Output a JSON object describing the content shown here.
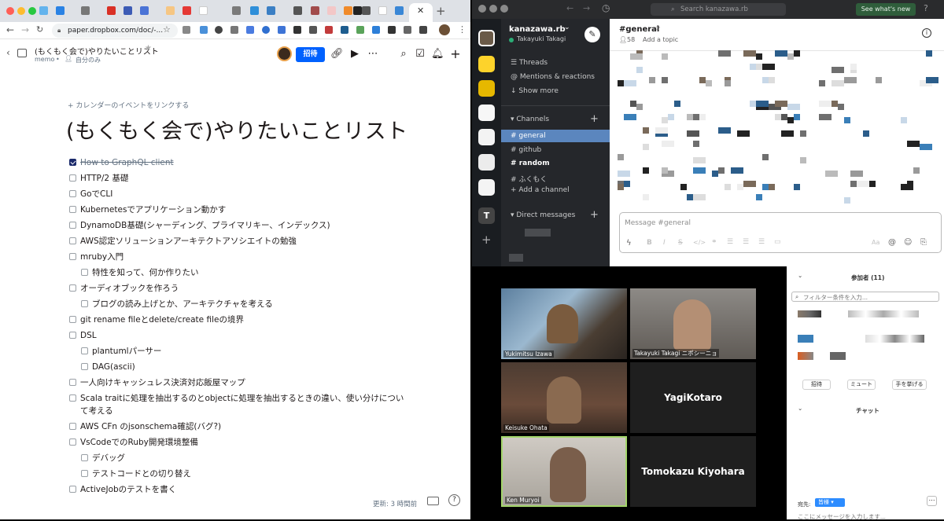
{
  "browser": {
    "url": "paper.dropbox.com/doc/-...",
    "colors": {
      "tabbar": "#dee1e6",
      "close": "#ff5f57",
      "minimize": "#febc2e",
      "maximize": "#28c840"
    }
  },
  "paper": {
    "doc_title_small": "(もくもく会で)やりたいことリスト",
    "meta_folder": "memo",
    "meta_sep": "•",
    "meta_visibility": "自分のみ",
    "share_label": "招待",
    "calendar_link": "+ カレンダーのイベントをリンクする",
    "title": "(もくもく会で)やりたいことリスト",
    "todos": [
      {
        "text": "How to GraphQL client",
        "checked": true
      },
      {
        "text": "HTTP/2 基礎",
        "checked": false
      },
      {
        "text": "GoでCLI",
        "checked": false
      },
      {
        "text": "Kubernetesでアプリケーション動かす",
        "checked": false
      },
      {
        "text": "DynamoDB基礎(シャーディング、プライマリキー、インデックス)",
        "checked": false
      },
      {
        "text": "AWS認定ソリューションアーキテクトアソシエイトの勉強",
        "checked": false
      },
      {
        "text": "mruby入門",
        "checked": false
      },
      {
        "text": "特性を知って、何か作りたい",
        "checked": false
      },
      {
        "text": "オーディオブックを作ろう",
        "checked": false
      },
      {
        "text": "ブログの読み上げとか、アーキテクチャを考える",
        "checked": false
      },
      {
        "text": "git rename fileとdelete/create fileの境界",
        "checked": false
      },
      {
        "text": "DSL",
        "checked": false
      },
      {
        "text": "plantumlパーサー",
        "checked": false
      },
      {
        "text": "DAG(ascii)",
        "checked": false
      },
      {
        "text": "一人向けキャッシュレス決済対応飯屋マップ",
        "checked": false
      },
      {
        "text": "Scala traitに処理を抽出するのとobjectに処理を抽出するときの違い、使い分けについ",
        "checked": false
      },
      {
        "text": "て考える",
        "checked": false
      },
      {
        "text": "AWS CFn のjsonschema確認(バグ?)",
        "checked": false
      },
      {
        "text": "VsCodeでのRuby開発環境整備",
        "checked": false
      },
      {
        "text": "デバッグ",
        "checked": false
      },
      {
        "text": "テストコードとの切り替え",
        "checked": false
      },
      {
        "text": "ActiveJobのテストを書く",
        "checked": false
      }
    ],
    "updated": "更新: 3 時間前",
    "help": "?"
  },
  "slack": {
    "search_placeholder": "Search kanazawa.rb",
    "whats_new": "See what's new",
    "workspace_name": "kanazawa.rb",
    "workspace_caret": "⌄",
    "user_name": "Takayuki Takagi",
    "threads": "Threads",
    "mentions": "Mentions & reactions",
    "show_more": "Show more",
    "channels_header": "Channels",
    "channels": [
      {
        "name": "general",
        "active": true,
        "bold": false
      },
      {
        "name": "github",
        "active": false,
        "bold": false
      },
      {
        "name": "random",
        "active": false,
        "bold": true
      },
      {
        "name": "ふくもく",
        "active": false,
        "bold": false
      }
    ],
    "add_channel": "Add a channel",
    "dm_header": "Direct messages",
    "channel_title": "#general",
    "member_count": "58",
    "add_topic": "Add a topic",
    "message_placeholder": "Message #general",
    "ws_letter": "T"
  },
  "zoom": {
    "participants": [
      {
        "name": "Yukimitsu Izawa",
        "video": true
      },
      {
        "name": "Takayuki Takagi ニポシーニョ",
        "video": true
      },
      {
        "name": "Keisuke Ohata",
        "video": true
      },
      {
        "name": "YagiKotaro",
        "video": false
      },
      {
        "name": "Ken Muryoi",
        "video": true
      },
      {
        "name": "Tomokazu Kiyohara",
        "video": false
      }
    ],
    "panel_participants": "参加者 (11)",
    "filter_placeholder": "フィルター条件を入力...",
    "invite": "招待",
    "mute": "ミュート",
    "raise_hand": "手を挙げる",
    "chat_header": "チャット",
    "to_label": "宛先:",
    "to_value": "皆様",
    "chat_placeholder": "ここにメッセージを入力します..."
  }
}
